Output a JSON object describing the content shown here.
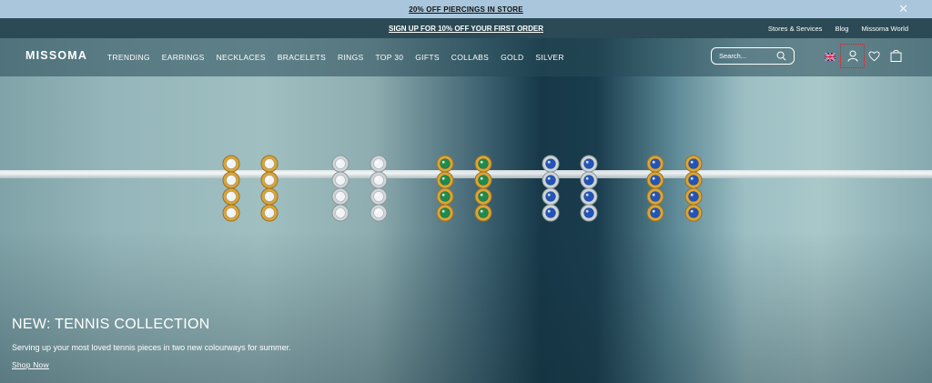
{
  "announcement": {
    "promo": "20% OFF PIERCINGS IN STORE",
    "close_icon": "close-icon"
  },
  "secondary_bar": {
    "signup": "SIGN UP FOR 10% OFF YOUR FIRST ORDER",
    "links": [
      "Stores & Services",
      "Blog",
      "Missoma World"
    ]
  },
  "header": {
    "logo": "MISSOMA",
    "menu": [
      "TRENDING",
      "EARRINGS",
      "NECKLACES",
      "BRACELETS",
      "RINGS",
      "TOP 30",
      "GIFTS",
      "COLLABS",
      "GOLD",
      "SILVER"
    ],
    "search": {
      "placeholder": "Search...",
      "value": ""
    },
    "icons": [
      "uk-flag-icon",
      "account-icon",
      "wishlist-heart-icon",
      "shopping-bag-icon"
    ]
  },
  "hero": {
    "title": "NEW: TENNIS COLLECTION",
    "subtitle": "Serving up your most loved tennis pieces in two new colourways for summer.",
    "cta": "Shop Now"
  },
  "colors": {
    "bar1": "#a9c6dc",
    "bar2": "#2b4a55",
    "gold": "#d9a63a",
    "silver": "#cfd6da",
    "emerald": "#1f8a4c",
    "sapphire": "#2355b8"
  },
  "earrings": [
    {
      "metal": "gold",
      "stone": "diamond"
    },
    {
      "metal": "silver",
      "stone": "diamond"
    },
    {
      "metal": "gold",
      "stone": "emerald"
    },
    {
      "metal": "silver",
      "stone": "sapphire"
    },
    {
      "metal": "gold",
      "stone": "sapphire"
    }
  ]
}
